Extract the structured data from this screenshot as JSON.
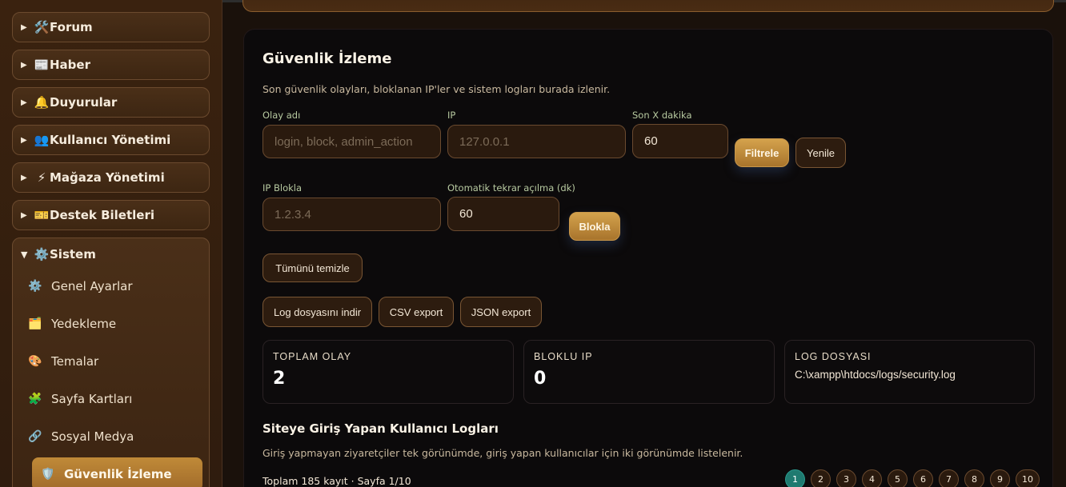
{
  "sidebar": {
    "items": [
      {
        "icon": "🛠️",
        "label": "Forum"
      },
      {
        "icon": "📰",
        "label": "Haber"
      },
      {
        "icon": "🔔",
        "label": "Duyurular"
      },
      {
        "icon": "👥",
        "label": "Kullanıcı Yönetimi"
      },
      {
        "icon": "⚡",
        "label": "Mağaza Yönetimi"
      },
      {
        "icon": "🎫",
        "label": "Destek Biletleri"
      }
    ],
    "group": {
      "icon": "⚙️",
      "label": "Sistem",
      "children": [
        {
          "icon": "⚙️",
          "label": "Genel Ayarlar"
        },
        {
          "icon": "🗂️",
          "label": "Yedekleme"
        },
        {
          "icon": "🎨",
          "label": "Temalar"
        },
        {
          "icon": "🧩",
          "label": "Sayfa Kartları"
        },
        {
          "icon": "🔗",
          "label": "Sosyal Medya"
        },
        {
          "icon": "🛡️",
          "label": "Güvenlik İzleme"
        }
      ]
    }
  },
  "main": {
    "title": "Güvenlik İzleme",
    "description": "Son güvenlik olayları, bloklanan IP'ler ve sistem logları burada izlenir.",
    "filter": {
      "event_label": "Olay adı",
      "event_placeholder": "login, block, admin_action",
      "ip_label": "IP",
      "ip_placeholder": "127.0.0.1",
      "minutes_label": "Son X dakika",
      "minutes_value": "60",
      "filter_button": "Filtrele",
      "refresh_button": "Yenile"
    },
    "block": {
      "ip_label": "IP Blokla",
      "ip_placeholder": "1.2.3.4",
      "auto_label": "Otomatik tekrar açılma (dk)",
      "auto_value": "60",
      "block_button": "Blokla"
    },
    "clear_button": "Tümünü temizle",
    "export": {
      "download_log": "Log dosyasını indir",
      "csv": "CSV export",
      "json": "JSON export"
    },
    "stats": {
      "total_label": "TOPLAM OLAY",
      "total_value": "2",
      "blocked_label": "BLOKLU IP",
      "blocked_value": "0",
      "logfile_label": "LOG DOSYASI",
      "logfile_value": "C:\\xampp\\htdocs/logs/security.log"
    },
    "section": {
      "title": "Siteye Giriş Yapan Kullanıcı Logları",
      "description": "Giriş yapmayan ziyaretçiler tek görünümde, giriş yapan kullanıcılar için iki görünümde listelenir.",
      "count_text": "Toplam 185 kayıt · Sayfa 1/10"
    },
    "pagination": [
      "1",
      "2",
      "3",
      "4",
      "5",
      "6",
      "7",
      "8",
      "9",
      "10"
    ],
    "active_page": "1"
  },
  "colors": {
    "accent_gold": "#c08a38",
    "active_page": "#1f7a70"
  }
}
